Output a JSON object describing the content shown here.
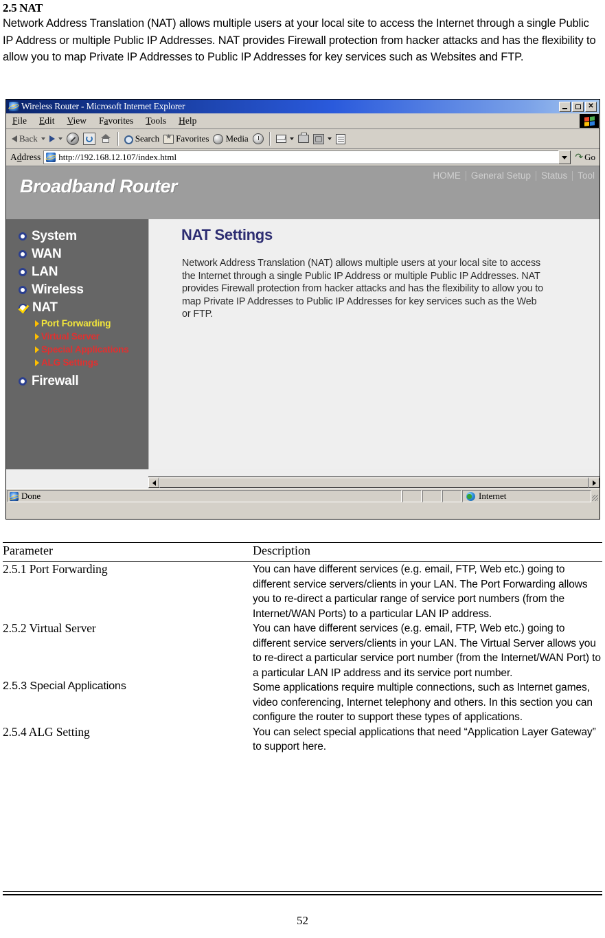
{
  "document": {
    "section_number_title": "2.5 NAT",
    "intro_paragraph": "Network Address Translation (NAT) allows multiple users at your local site to access the Internet through a single Public IP Address or multiple Public IP Addresses. NAT provides Firewall protection from hacker attacks and has the flexibility to allow you to map Private IP Addresses to Public IP Addresses for key services such as Websites and FTP.",
    "page_number": "52"
  },
  "browser": {
    "title": "Wireless Router - Microsoft Internet Explorer",
    "window_buttons": {
      "minimize": "_",
      "maximize": "□",
      "close": "✕"
    },
    "menu": [
      {
        "label": "File",
        "accel": "F"
      },
      {
        "label": "Edit",
        "accel": "E"
      },
      {
        "label": "View",
        "accel": "V"
      },
      {
        "label": "Favorites",
        "accel": "a"
      },
      {
        "label": "Tools",
        "accel": "T"
      },
      {
        "label": "Help",
        "accel": "H"
      }
    ],
    "toolbar": {
      "back": "Back",
      "forward": "",
      "stop": "",
      "refresh": "",
      "home": "",
      "search": "Search",
      "favorites": "Favorites",
      "media": "Media",
      "history": "",
      "mail": "",
      "print": "",
      "edit": "",
      "discuss": ""
    },
    "address": {
      "label": "Address",
      "value": "http://192.168.12.107/index.html",
      "go_label": "Go",
      "go_icon": "↷"
    },
    "status": {
      "text": "Done",
      "zone": "Internet"
    }
  },
  "router_page": {
    "brand": "Broadband Router",
    "topnav": [
      "HOME",
      "General Setup",
      "Status",
      "Tool"
    ],
    "sidebar": {
      "items": [
        {
          "label": "System",
          "icon": "bullet"
        },
        {
          "label": "WAN",
          "icon": "bullet"
        },
        {
          "label": "LAN",
          "icon": "bullet"
        },
        {
          "label": "Wireless",
          "icon": "bullet"
        },
        {
          "label": "NAT",
          "icon": "check"
        }
      ],
      "sub_items": [
        {
          "label": "Port Forwarding",
          "color": "#f2e53c"
        },
        {
          "label": "Virtual Server",
          "color": "#e03030"
        },
        {
          "label": "Special Applications",
          "color": "#e03030"
        },
        {
          "label": "ALG Settings",
          "color": "#e03030"
        }
      ],
      "last_item": {
        "label": "Firewall",
        "icon": "bullet"
      }
    },
    "content": {
      "title": "NAT Settings",
      "title_color": "#2d2d72",
      "description": "Network Address Translation (NAT) allows multiple users at your local site to access the Internet through a single Public IP Address or multiple Public IP Addresses. NAT provides Firewall protection from hacker attacks and has the flexibility to allow you to map Private IP Addresses to Public IP Addresses for key services such as the Web or FTP."
    }
  },
  "parameter_table": {
    "headers": [
      "Parameter",
      "Description"
    ],
    "rows": [
      {
        "parameter": "2.5.1 Port Forwarding",
        "description": "You can have different services (e.g. email, FTP, Web etc.) going to different service servers/clients in your LAN. The Port Forwarding allows you to re-direct a particular range of service port numbers (from the Internet/WAN Ports) to a particular LAN IP address."
      },
      {
        "parameter": "2.5.2 Virtual Server",
        "description": "You can have different services (e.g. email, FTP, Web etc.) going to different service servers/clients in your LAN. The Virtual Server allows you to re-direct a particular service port number (from the Internet/WAN Port) to a particular LAN IP address and its service port number."
      },
      {
        "parameter": "2.5.3 Special Applications",
        "description": "Some applications require multiple connections, such as Internet games, video conferencing, Internet telephony and others. In this section you can configure the router to support these types of applications."
      },
      {
        "parameter": "2.5.4 ALG Setting",
        "description": "You can select special applications that need “Application Layer Gateway” to support here."
      }
    ]
  }
}
